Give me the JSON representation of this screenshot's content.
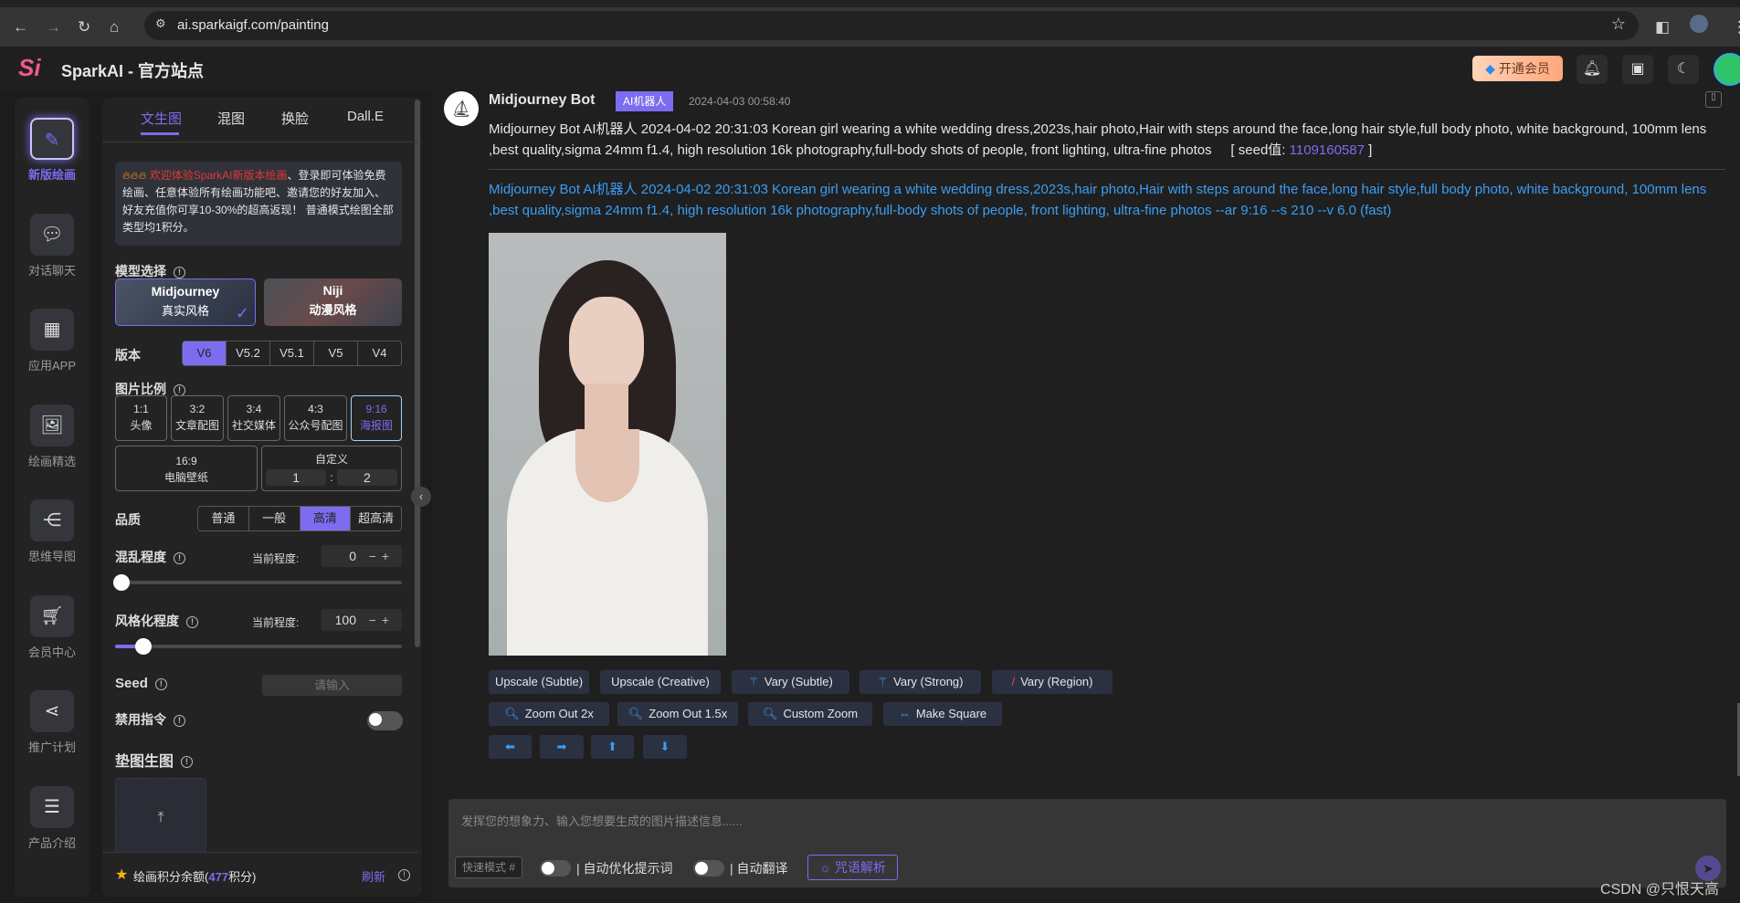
{
  "browser": {
    "url": "ai.sparkaigf.com/painting"
  },
  "header": {
    "title": "SparkAI - 官方站点",
    "vip_label": "开通会员"
  },
  "sidebar": {
    "items": [
      {
        "label": "新版绘画",
        "icon": "paint-icon",
        "active": true
      },
      {
        "label": "对话聊天",
        "icon": "chat-icon"
      },
      {
        "label": "应用APP",
        "icon": "apps-icon"
      },
      {
        "label": "绘画精选",
        "icon": "gallery-icon"
      },
      {
        "label": "思维导图",
        "icon": "mindmap-icon"
      },
      {
        "label": "会员中心",
        "icon": "cart-icon"
      },
      {
        "label": "推广计划",
        "icon": "share-icon"
      },
      {
        "label": "产品介绍",
        "icon": "product-icon"
      }
    ]
  },
  "panel": {
    "tabs": [
      "文生图",
      "混图",
      "换脸",
      "Dall.E"
    ],
    "notice_highlight": "欢迎体验SparkAI新版本绘画",
    "notice_text": "、登录即可体验免费绘画、任意体验所有绘画功能吧、邀请您的好友加入、好友充值你可享10-30%的超高返现！ 普通模式绘图全部类型均1积分。",
    "model_label": "模型选择",
    "models": [
      {
        "name": "Midjourney",
        "style": "真实风格",
        "selected": true
      },
      {
        "name": "Niji",
        "style": "动漫风格"
      }
    ],
    "version_label": "版本",
    "versions": [
      "V6",
      "V5.2",
      "V5.1",
      "V5",
      "V4"
    ],
    "version_selected": "V6",
    "ratio_label": "图片比例",
    "ratios": [
      {
        "r": "1:1",
        "n": "头像"
      },
      {
        "r": "3:2",
        "n": "文章配图"
      },
      {
        "r": "3:4",
        "n": "社交媒体"
      },
      {
        "r": "4:3",
        "n": "公众号配图"
      },
      {
        "r": "9:16",
        "n": "海报图",
        "selected": true
      }
    ],
    "ratio_wide": {
      "r": "16:9",
      "n": "电脑壁纸"
    },
    "custom": {
      "label": "自定义",
      "w": "1",
      "sep": ":",
      "h": "2"
    },
    "quality_label": "品质",
    "qualities": [
      "普通",
      "一般",
      "高清",
      "超高清"
    ],
    "quality_selected": "高清",
    "chaos": {
      "label": "混乱程度",
      "cur_label": "当前程度:",
      "value": "0",
      "max": 100
    },
    "stylize": {
      "label": "风格化程度",
      "cur_label": "当前程度:",
      "value": "100",
      "max": 1000
    },
    "seed": {
      "label": "Seed",
      "placeholder": "请输入"
    },
    "no_cmd": {
      "label": "禁用指令",
      "on": false
    },
    "image_ref_label": "垫图生图",
    "footer": {
      "prefix": "绘画积分余额(",
      "points": "477",
      "suffix": "积分)",
      "refresh": "刷新"
    }
  },
  "message": {
    "bot": "Midjourney Bot",
    "badge": "AI机器人",
    "time": "2024-04-03 00:58:40",
    "prompt": "Midjourney Bot AI机器人 2024-04-02 20:31:03 Korean girl wearing a white wedding dress,2023s,hair photo,Hair with steps around the face,long hair style,full body photo, white background, 100mm lens ,best quality,sigma 24mm f1.4, high resolution 16k photography,full-body shots of people, front lighting, ultra-fine photos",
    "seed_label": "[ seed值:",
    "seed": "1109160587",
    "seed_close": "]",
    "full_prompt": "Midjourney Bot AI机器人 2024-04-02 20:31:03 Korean girl wearing a white wedding dress,2023s,hair photo,Hair with steps around the face,long hair style,full body photo, white background, 100mm lens ,best quality,sigma 24mm f1.4, high resolution 16k photography,full-body shots of people, front lighting, ultra-fine photos --ar 9:16 --s 210 --v 6.0  (fast)",
    "buttons_row1": [
      "Upscale (Subtle)",
      "Upscale (Creative)",
      "Vary (Subtle)",
      "Vary (Strong)",
      "Vary (Region)"
    ],
    "buttons_row2": [
      "Zoom Out 2x",
      "Zoom Out 1.5x",
      "Custom Zoom",
      "Make Square"
    ],
    "pan": [
      "⬅",
      "➡",
      "⬆",
      "⬇"
    ]
  },
  "input": {
    "placeholder": "发挥您的想象力、输入您想要生成的图片描述信息......",
    "mode": "快速模式 #",
    "auto_optimize": "自动优化提示词",
    "auto_translate": "自动翻译",
    "analyze": "咒语解析"
  },
  "watermark": "CSDN @只恨天高",
  "colors": {
    "accent": "#7c6cf0",
    "link": "#3a9ef5",
    "notice": "#e53935"
  }
}
